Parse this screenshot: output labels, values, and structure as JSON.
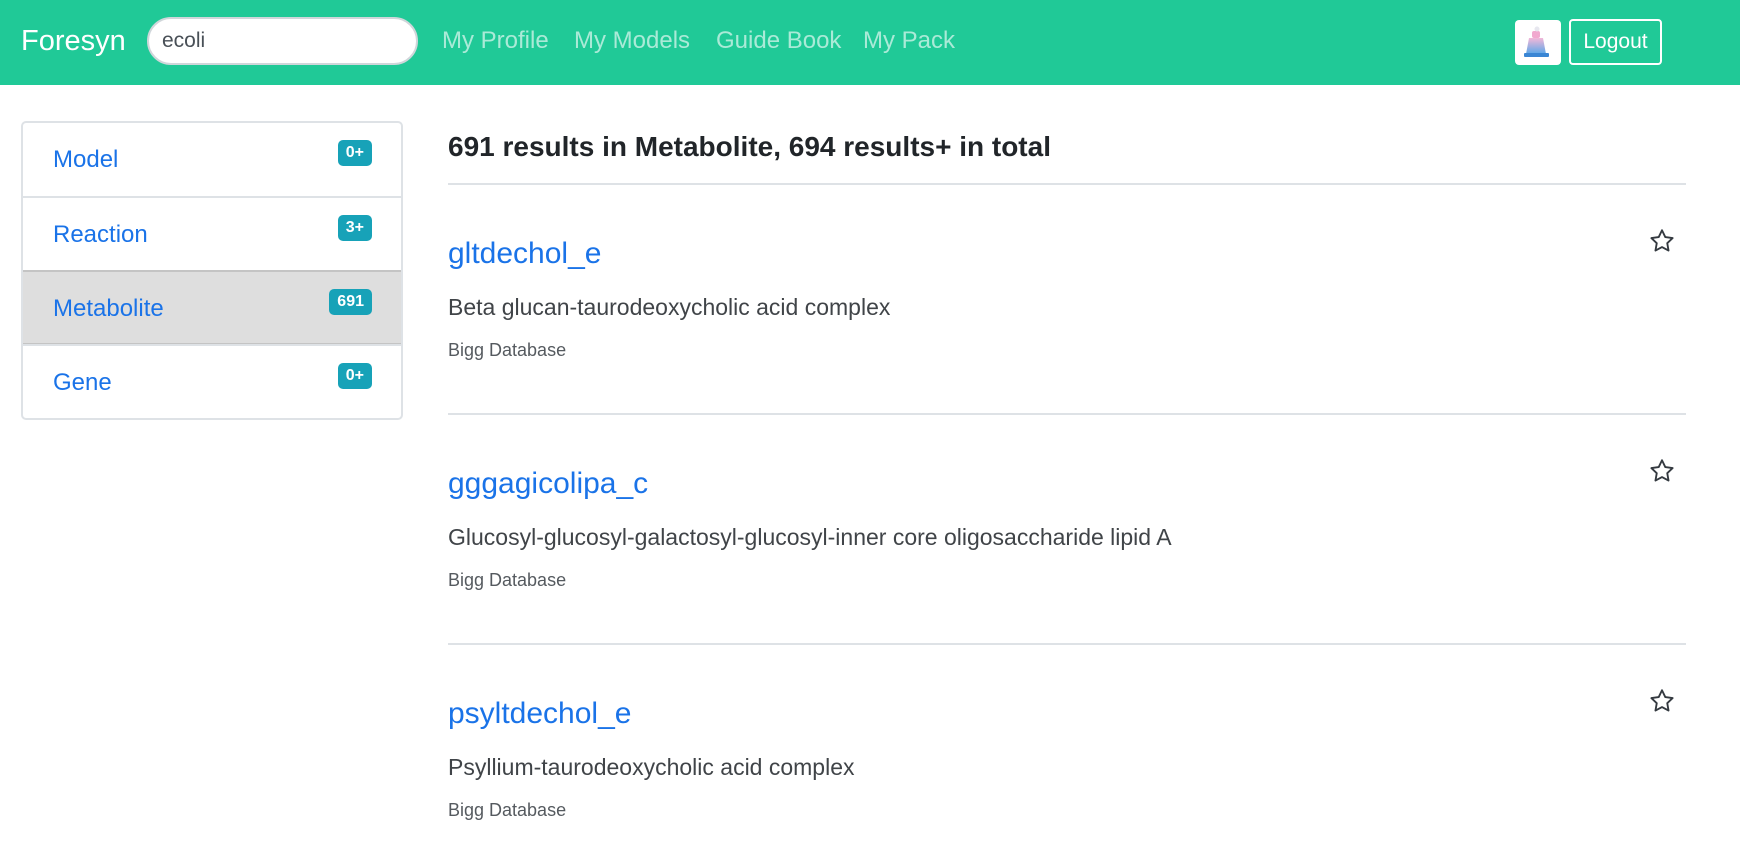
{
  "nav": {
    "brand": "Foresyn",
    "search_value": "ecoli",
    "links": [
      "My Profile",
      "My Models",
      "Guide Book",
      "My Pack"
    ],
    "logout_label": "Logout"
  },
  "sidebar": {
    "items": [
      {
        "label": "Model",
        "count": "0+"
      },
      {
        "label": "Reaction",
        "count": "3+"
      },
      {
        "label": "Metabolite",
        "count": "691"
      },
      {
        "label": "Gene",
        "count": "0+"
      }
    ],
    "active": "Metabolite"
  },
  "main": {
    "summary": "691 results in Metabolite, 694 results+ in total",
    "results": [
      {
        "id": "gltdechol_e",
        "description": "Beta glucan-taurodeoxycholic acid complex",
        "source": "Bigg Database"
      },
      {
        "id": "gggagicolipa_c",
        "description": "Glucosyl-glucosyl-galactosyl-glucosyl-inner core oligosaccharide lipid A",
        "source": "Bigg Database"
      },
      {
        "id": "psyltdechol_e",
        "description": "Psyllium-taurodeoxycholic acid complex",
        "source": "Bigg Database"
      }
    ]
  },
  "colors": {
    "navbar": "#20c997",
    "link": "#1a73e8",
    "badge": "#17a2b8",
    "active_bg": "#dedede"
  },
  "icons": {
    "favorite": "star-outline-icon",
    "avatar": "user-avatar-icon"
  }
}
